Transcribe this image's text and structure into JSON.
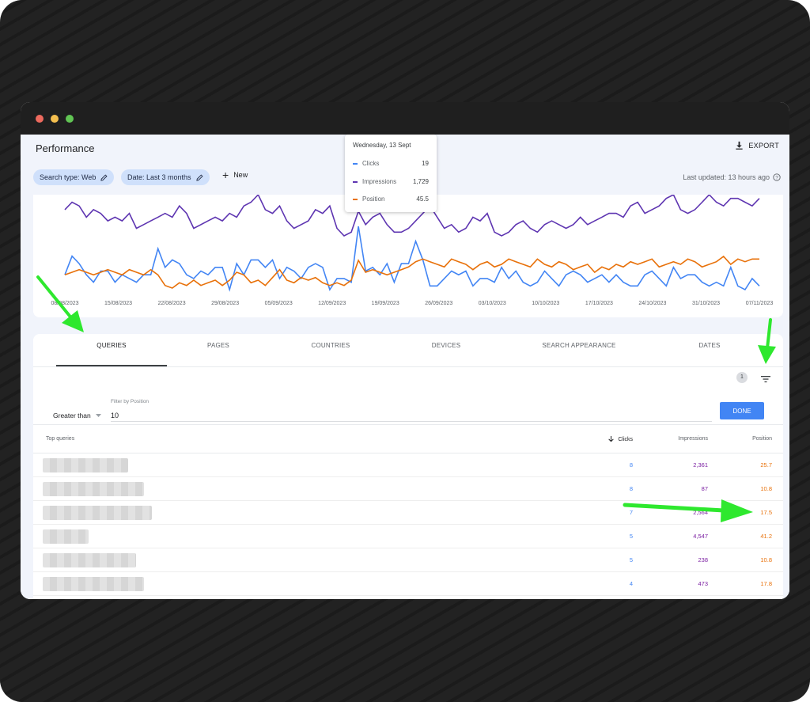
{
  "app": {
    "title": "Performance",
    "export_label": "EXPORT",
    "last_updated": "Last updated: 13 hours ago"
  },
  "filters": {
    "search_type": "Search type: Web",
    "date": "Date: Last 3 months",
    "new_label": "New"
  },
  "tooltip": {
    "date": "Wednesday, 13 Sept",
    "rows": [
      {
        "label": "Clicks",
        "value": "19",
        "color": "#4285f4"
      },
      {
        "label": "Impressions",
        "value": "1,729",
        "color": "#5e35b1"
      },
      {
        "label": "Position",
        "value": "45.5",
        "color": "#e8710a"
      }
    ]
  },
  "chart_data": {
    "type": "line",
    "x_ticks": [
      "08/08/2023",
      "15/08/2023",
      "22/08/2023",
      "29/08/2023",
      "05/09/2023",
      "12/09/2023",
      "19/09/2023",
      "26/09/2023",
      "03/10/2023",
      "10/10/2023",
      "17/10/2023",
      "24/10/2023",
      "31/10/2023",
      "07/11/2023"
    ],
    "series": [
      {
        "name": "Clicks",
        "color": "#4285f4",
        "values": [
          6,
          11,
          9,
          6,
          4,
          7,
          7,
          4,
          6,
          5,
          4,
          6,
          6,
          13,
          8,
          10,
          9,
          6,
          5,
          7,
          6,
          8,
          8,
          2,
          9,
          6,
          10,
          10,
          8,
          10,
          5,
          8,
          7,
          5,
          8,
          9,
          8,
          2,
          5,
          5,
          4,
          19,
          7,
          8,
          6,
          9,
          4,
          9,
          9,
          15,
          10,
          3,
          3,
          5,
          7,
          6,
          7,
          3,
          5,
          5,
          4,
          8,
          5,
          7,
          4,
          3,
          4,
          7,
          5,
          3,
          6,
          7,
          6,
          4,
          5,
          6,
          4,
          6,
          4,
          3,
          3,
          6,
          7,
          5,
          3,
          8,
          5,
          6,
          6,
          4,
          3,
          4,
          3,
          8,
          3,
          2,
          5,
          3
        ]
      },
      {
        "name": "Impressions",
        "color": "#5e35b1",
        "values": [
          1750,
          1850,
          1800,
          1650,
          1750,
          1700,
          1600,
          1650,
          1600,
          1700,
          1500,
          1550,
          1600,
          1650,
          1700,
          1650,
          1800,
          1700,
          1500,
          1550,
          1600,
          1650,
          1600,
          1700,
          1650,
          1800,
          1850,
          1950,
          1750,
          1700,
          1800,
          1600,
          1500,
          1550,
          1600,
          1750,
          1700,
          1800,
          1500,
          1400,
          1450,
          1729,
          1550,
          1650,
          1700,
          1550,
          1450,
          1450,
          1500,
          1600,
          1700,
          1800,
          1650,
          1500,
          1550,
          1450,
          1500,
          1650,
          1600,
          1700,
          1450,
          1400,
          1450,
          1550,
          1600,
          1500,
          1450,
          1550,
          1600,
          1550,
          1500,
          1550,
          1650,
          1550,
          1600,
          1650,
          1700,
          1700,
          1650,
          1800,
          1850,
          1700,
          1750,
          1800,
          1900,
          1950,
          1750,
          1700,
          1750,
          1850,
          1950,
          1850,
          1800,
          1900,
          1900,
          1850,
          1800,
          1900
        ]
      },
      {
        "name": "Position",
        "color": "#e8710a",
        "values": [
          40,
          41,
          42,
          41,
          40,
          41,
          42,
          41,
          40,
          42,
          41,
          40,
          42,
          40,
          36,
          35,
          37,
          36,
          38,
          36,
          37,
          38,
          36,
          38,
          41,
          40,
          37,
          38,
          36,
          39,
          42,
          38,
          37,
          39,
          38,
          39,
          37,
          36,
          37,
          36,
          38,
          45.5,
          41,
          42,
          41,
          40,
          41,
          42,
          43,
          45,
          46,
          45,
          44,
          43,
          46,
          45,
          44,
          42,
          44,
          45,
          43,
          44,
          46,
          45,
          44,
          43,
          46,
          44,
          43,
          45,
          44,
          42,
          43,
          44,
          41,
          43,
          42,
          44,
          43,
          45,
          44,
          45,
          46,
          43,
          44,
          45,
          44,
          46,
          45,
          43,
          44,
          45,
          47,
          44,
          46,
          45,
          46,
          46
        ]
      }
    ]
  },
  "tabs": [
    "QUERIES",
    "PAGES",
    "COUNTRIES",
    "DEVICES",
    "SEARCH APPEARANCE",
    "DATES"
  ],
  "filter_count": "1",
  "position_filter": {
    "comparator": "Greater than",
    "label": "Filter by Position",
    "value": "10",
    "done_label": "DONE"
  },
  "table": {
    "headers": {
      "query": "Top queries",
      "clicks": "Clicks",
      "impressions": "Impressions",
      "position": "Position"
    },
    "rows": [
      {
        "clicks": "8",
        "impressions": "2,361",
        "position": "25.7"
      },
      {
        "clicks": "8",
        "impressions": "87",
        "position": "10.8"
      },
      {
        "clicks": "7",
        "impressions": "2,564",
        "position": "17.5"
      },
      {
        "clicks": "5",
        "impressions": "4,547",
        "position": "41.2"
      },
      {
        "clicks": "5",
        "impressions": "238",
        "position": "10.8"
      },
      {
        "clicks": "4",
        "impressions": "473",
        "position": "17.8"
      }
    ]
  },
  "colors": {
    "accent": "#4285f4",
    "annotation_arrow": "#2ee82e"
  }
}
